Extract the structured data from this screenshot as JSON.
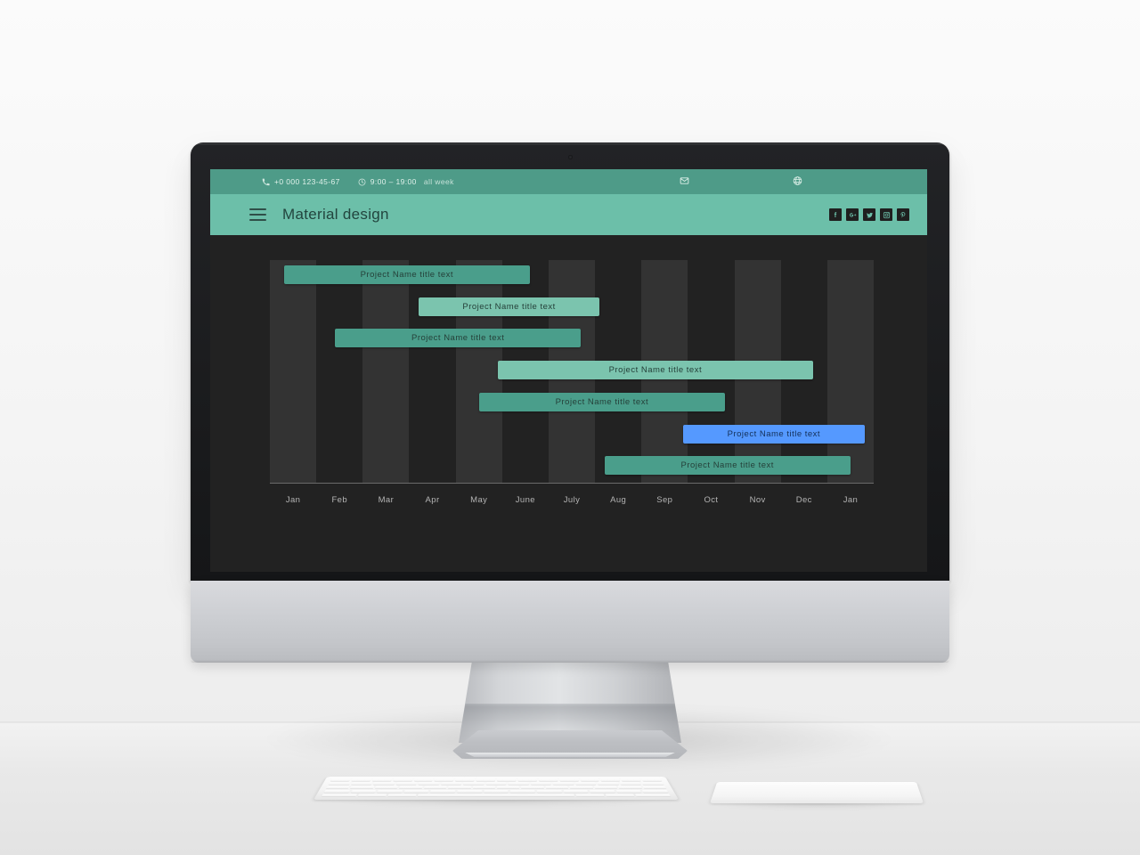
{
  "topbar": {
    "phone_icon": "phone-icon",
    "phone": "+0 000 123-45-67",
    "clock_icon": "clock-icon",
    "hours": "9:00 – 19:00",
    "week": "all week",
    "mail_icon": "mail-icon",
    "globe_icon": "globe-icon"
  },
  "navbar": {
    "menu_icon": "hamburger-menu-icon",
    "brand": "Material design",
    "socials": [
      {
        "name": "facebook-icon",
        "glyph": "f"
      },
      {
        "name": "google-plus-icon",
        "glyph": "g+"
      },
      {
        "name": "twitter-icon",
        "glyph": "t"
      },
      {
        "name": "instagram-icon",
        "glyph": "◎"
      },
      {
        "name": "pinterest-icon",
        "glyph": "p"
      }
    ]
  },
  "colors": {
    "topbar_green": "#4e9b88",
    "navbar_green": "#6cbfa9",
    "bar_dark_teal": "#4a9e8b",
    "bar_light_teal": "#7bc4ae",
    "bar_blue": "#5599ff",
    "screen_bg": "#222222",
    "stripe": "#333333"
  },
  "chart_data": {
    "type": "bar",
    "title": "",
    "xlabel": "",
    "ylabel": "",
    "orientation": "horizontal",
    "categories": [
      "Jan",
      "Feb",
      "Mar",
      "Apr",
      "May",
      "June",
      "July",
      "Aug",
      "Sep",
      "Oct",
      "Nov",
      "Dec",
      "Jan"
    ],
    "axis_tick_labels": [
      "Jan",
      "Feb",
      "Mar",
      "Apr",
      "May",
      "June",
      "July",
      "Aug",
      "Sep",
      "Oct",
      "Nov",
      "Dec",
      "Jan"
    ],
    "grid": "vertical-alternating-stripes",
    "legend": "none",
    "tasks": [
      {
        "label": "Project Name title  text",
        "start_month": 0.3,
        "end_month": 5.6,
        "color": "#4a9e8b",
        "row": 0
      },
      {
        "label": "Project Name title  text",
        "start_month": 3.2,
        "end_month": 7.1,
        "color": "#7bc4ae",
        "row": 1
      },
      {
        "label": "Project Name title  text",
        "start_month": 1.4,
        "end_month": 6.7,
        "color": "#4a9e8b",
        "row": 2
      },
      {
        "label": "Project Name title  text",
        "start_month": 4.9,
        "end_month": 11.7,
        "color": "#7bc4ae",
        "row": 3
      },
      {
        "label": "Project Name title  text",
        "start_month": 4.5,
        "end_month": 9.8,
        "color": "#4a9e8b",
        "row": 4
      },
      {
        "label": "Project Name title  text",
        "start_month": 8.9,
        "end_month": 12.8,
        "color": "#5599ff",
        "row": 5
      },
      {
        "label": "Project Name title  text",
        "start_month": 7.2,
        "end_month": 12.5,
        "color": "#4a9e8b",
        "row": 6
      }
    ]
  },
  "desk": {
    "keyboard": "apple-keyboard",
    "trackpad": "apple-trackpad"
  }
}
